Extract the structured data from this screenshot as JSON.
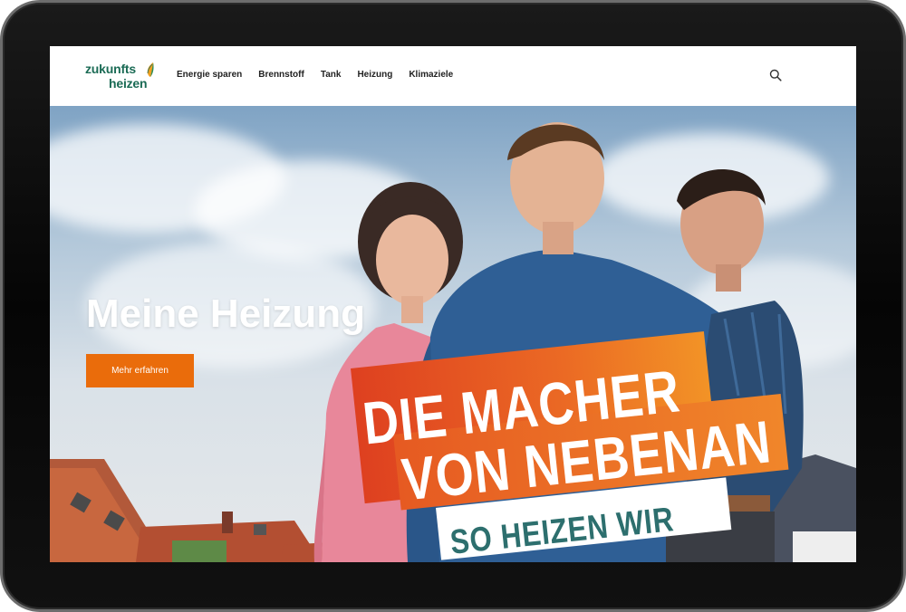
{
  "logo": {
    "line1": "zukunfts",
    "line2": "heizen"
  },
  "nav": {
    "items": [
      {
        "label": "Energie sparen"
      },
      {
        "label": "Brennstoff"
      },
      {
        "label": "Tank"
      },
      {
        "label": "Heizung"
      },
      {
        "label": "Klimaziele"
      }
    ]
  },
  "search": {
    "icon": "search-icon"
  },
  "hero": {
    "title": "Meine Heizung",
    "button_label": "Mehr erfahren",
    "banner_line1": "DIE MACHER",
    "banner_line2": "VON NEBENAN",
    "banner_line3": "SO HEIZEN WIR"
  },
  "colors": {
    "brand_green": "#1b6b55",
    "accent_orange": "#ea6c0b",
    "banner_teal": "#2d6f6e"
  }
}
